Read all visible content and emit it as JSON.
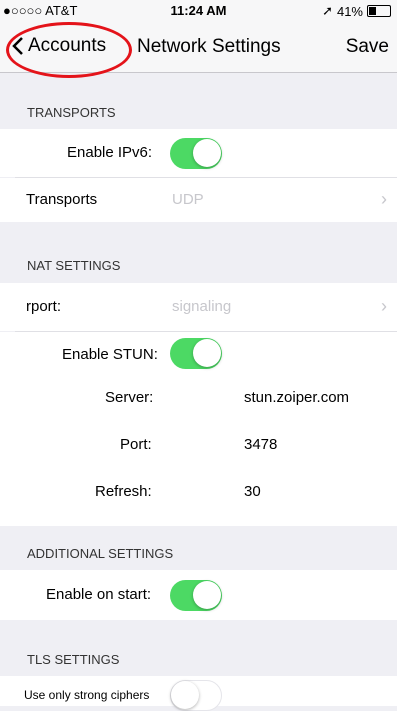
{
  "status_bar": {
    "carrier": "●○○○○ AT&T",
    "time": "11:24 AM",
    "battery": "41%",
    "battery_level": 0.41
  },
  "nav": {
    "back_label": "Accounts",
    "title": "Network Settings",
    "save_label": "Save"
  },
  "transports_section": {
    "header": "TRANSPORTS",
    "enable_ipv6_label": "Enable IPv6:",
    "enable_ipv6_on": true,
    "transports_label": "Transports",
    "transports_value": "UDP"
  },
  "nat_section": {
    "header": "NAT SETTINGS",
    "rport_label": "rport:",
    "rport_value": "signaling",
    "enable_stun_label": "Enable STUN:",
    "enable_stun_on": true,
    "server_label": "Server:",
    "server_value": "stun.zoiper.com",
    "port_label": "Port:",
    "port_value": "3478",
    "refresh_label": "Refresh:",
    "refresh_value": "30"
  },
  "additional_section": {
    "header": "ADDITIONAL SETTINGS",
    "enable_on_start_label": "Enable on start:",
    "enable_on_start_on": true
  },
  "tls_section": {
    "header": "TLS SETTINGS",
    "strong_ciphers_label": "Use only strong ciphers",
    "strong_ciphers_on": false
  },
  "colors": {
    "toggle_on": "#4cd964",
    "annotation": "#e4131a",
    "background": "#efeff4"
  }
}
